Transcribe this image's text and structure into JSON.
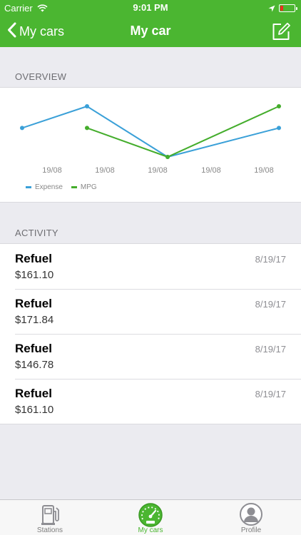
{
  "status_bar": {
    "carrier": "Carrier",
    "time": "9:01 PM",
    "battery_color": "#e9301f"
  },
  "nav": {
    "back_label": "My cars",
    "title": "My car",
    "edit_icon": "compose-icon",
    "background_color": "#4bb631"
  },
  "overview": {
    "header": "OVERVIEW"
  },
  "chart_data": {
    "type": "line",
    "categories": [
      "19/08",
      "19/08",
      "19/08",
      "19/08",
      "19/08"
    ],
    "series": [
      {
        "name": "Expense",
        "color": "#3aa0d8",
        "values": [
          161.1,
          171.84,
          146.78,
          null,
          161.1
        ]
      },
      {
        "name": "MPG",
        "color": "#44ad2c",
        "values": [
          null,
          161.1,
          146.78,
          null,
          171.84
        ]
      }
    ],
    "grid": false,
    "legend": "bottom-left"
  },
  "activity": {
    "header": "ACTIVITY",
    "items": [
      {
        "type": "Refuel",
        "amount": "$161.10",
        "date": "8/19/17"
      },
      {
        "type": "Refuel",
        "amount": "$171.84",
        "date": "8/19/17"
      },
      {
        "type": "Refuel",
        "amount": "$146.78",
        "date": "8/19/17"
      },
      {
        "type": "Refuel",
        "amount": "$161.10",
        "date": "8/19/17"
      }
    ]
  },
  "tabs": [
    {
      "label": "Stations",
      "icon": "fuel-pump-icon",
      "active": false
    },
    {
      "label": "My cars",
      "icon": "speedometer-icon",
      "active": true
    },
    {
      "label": "Profile",
      "icon": "user-icon",
      "active": false
    }
  ]
}
